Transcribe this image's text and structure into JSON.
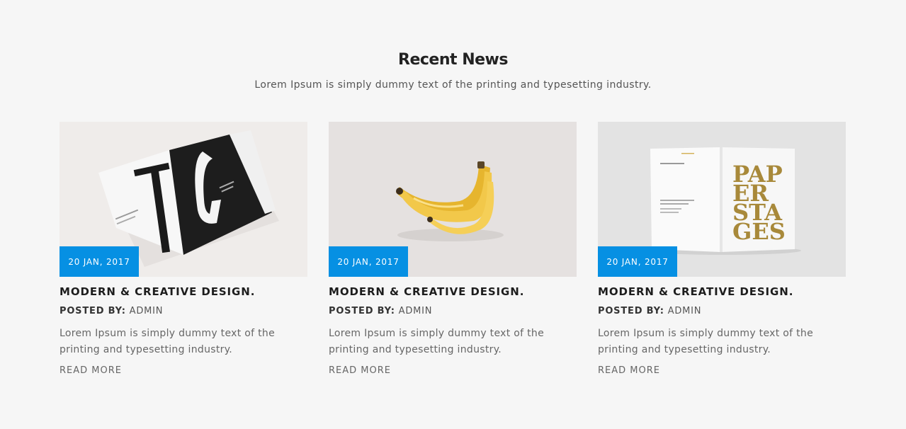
{
  "section": {
    "title": "Recent News",
    "subtitle": "Lorem Ipsum is simply dummy text of the printing and typesetting industry."
  },
  "colors": {
    "background": "#f6f6f6",
    "badge": "#0690e3"
  },
  "posts": [
    {
      "date": "20 JAN, 2017",
      "title": "MODERN & CREATIVE DESIGN.",
      "posted_by_label": "POSTED BY:",
      "author": "ADMIN",
      "excerpt": "Lorem Ipsum is simply dummy text of the printing and typesetting industry.",
      "read_more": "READ MORE",
      "image": "magazine-tg-image"
    },
    {
      "date": "20 JAN, 2017",
      "title": "MODERN & CREATIVE DESIGN.",
      "posted_by_label": "POSTED BY:",
      "author": "ADMIN",
      "excerpt": "Lorem Ipsum is simply dummy text of the printing and typesetting industry.",
      "read_more": "READ MORE",
      "image": "bananas-image"
    },
    {
      "date": "20 JAN, 2017",
      "title": "MODERN & CREATIVE DESIGN.",
      "posted_by_label": "POSTED BY:",
      "author": "ADMIN",
      "excerpt": "Lorem Ipsum is simply dummy text of the printing and typesetting industry.",
      "read_more": "READ MORE",
      "image": "paper-stages-book-image",
      "image_text": [
        "PAP",
        "ER",
        "STA",
        "GES"
      ]
    }
  ]
}
